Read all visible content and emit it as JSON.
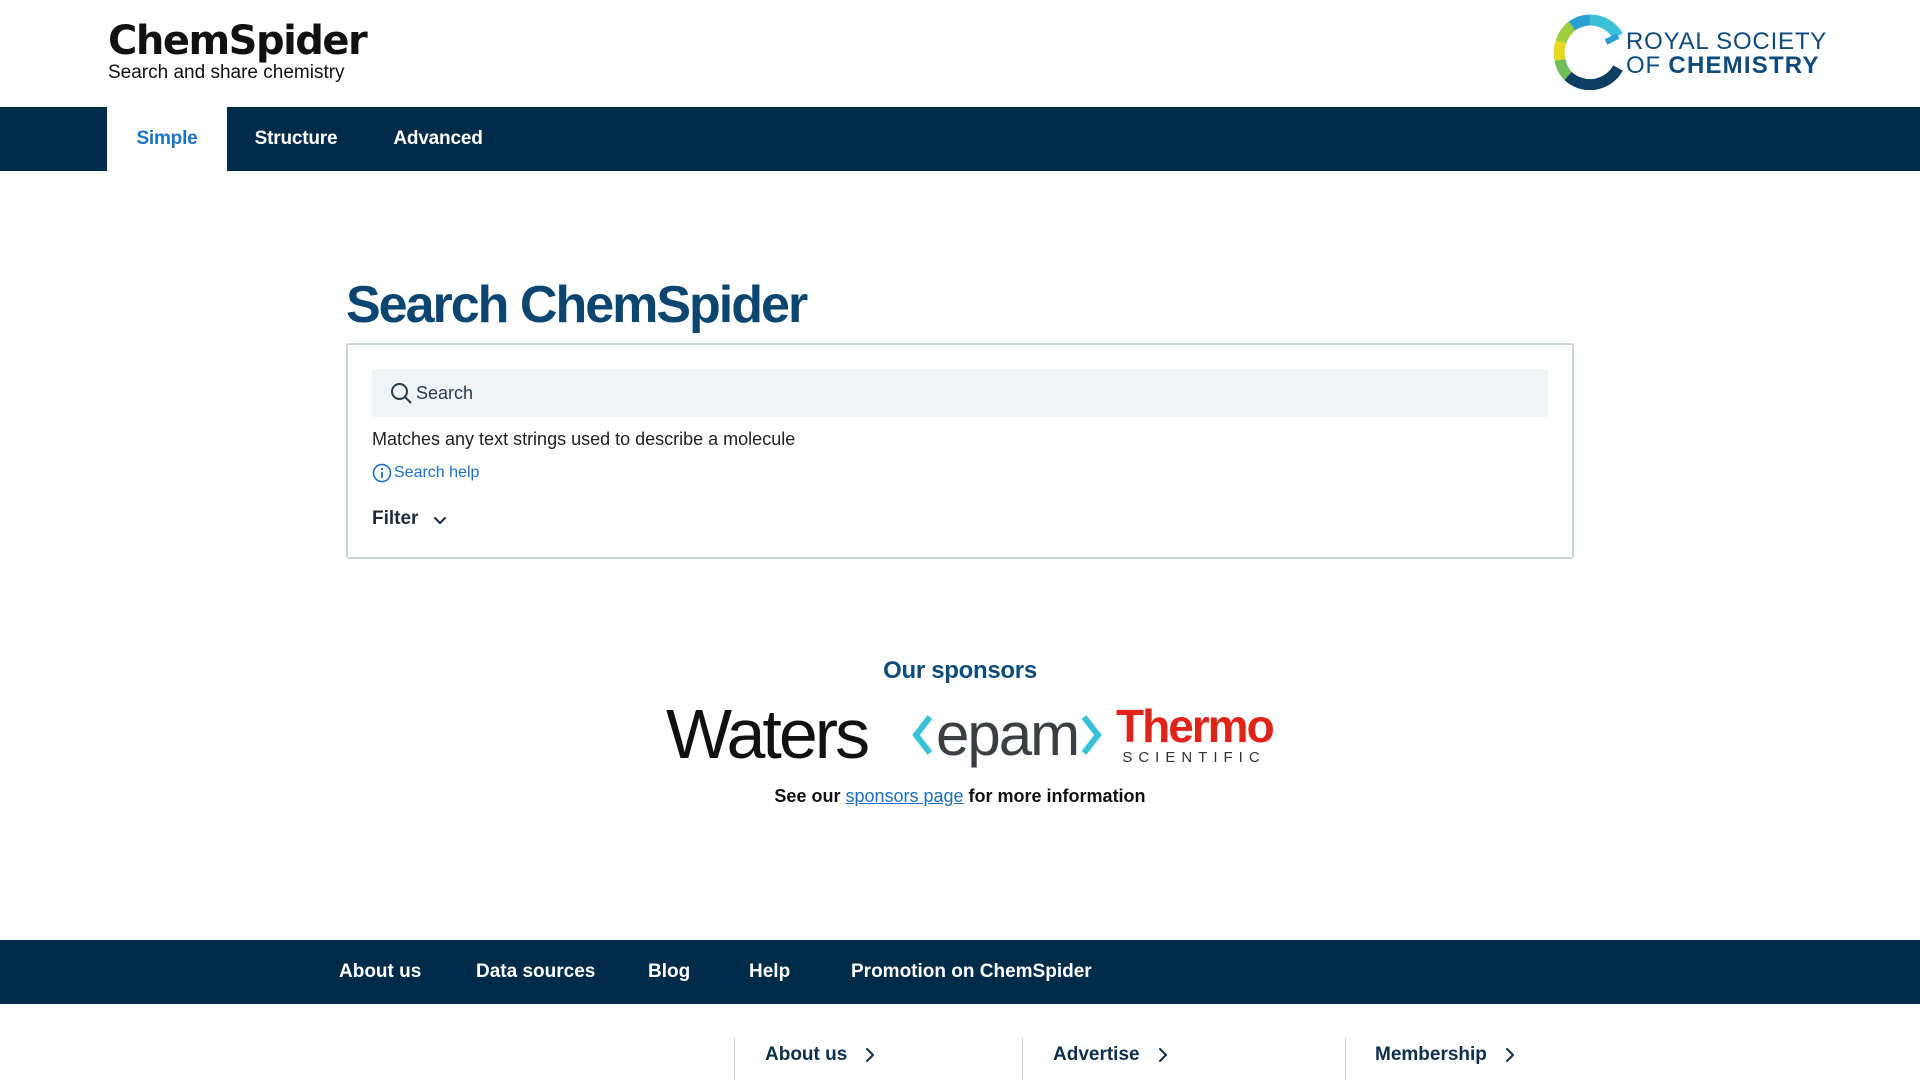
{
  "header": {
    "logo_name": "ChemSpider",
    "logo_tagline": "Search and share chemistry",
    "rsc_line1": "ROYAL SOCIETY",
    "rsc_line2_prefix": "OF ",
    "rsc_line2_bold": "CHEMISTRY"
  },
  "nav": {
    "tabs": [
      {
        "label": "Simple",
        "active": true
      },
      {
        "label": "Structure",
        "active": false
      },
      {
        "label": "Advanced",
        "active": false
      }
    ]
  },
  "main": {
    "title": "Search ChemSpider",
    "search": {
      "placeholder": "Search",
      "value": "",
      "description": "Matches any text strings used to describe a molecule",
      "help_label": "Search help",
      "filter_label": "Filter"
    }
  },
  "sponsors": {
    "heading": "Our sponsors",
    "logos": [
      "Waters",
      "epam",
      "Thermo"
    ],
    "thermo_sub": "SCIENTIFIC",
    "note_prefix": "See our ",
    "note_link": "sponsors page",
    "note_suffix": " for more information"
  },
  "footer_nav": {
    "links": [
      "About us",
      "Data sources",
      "Blog",
      "Help",
      "Promotion on ChemSpider"
    ]
  },
  "footer_lower": {
    "links": [
      "About us",
      "Advertise",
      "Membership"
    ]
  },
  "colors": {
    "navy": "#002b49",
    "title_blue": "#0c4670",
    "link_blue": "#1a6fc4",
    "thermo_red": "#e2231a",
    "epam_cyan": "#39c2d7"
  },
  "icons": [
    "search-icon",
    "info-icon",
    "chevron-down-icon",
    "chevron-right-icon",
    "rsc-logo-mark"
  ]
}
